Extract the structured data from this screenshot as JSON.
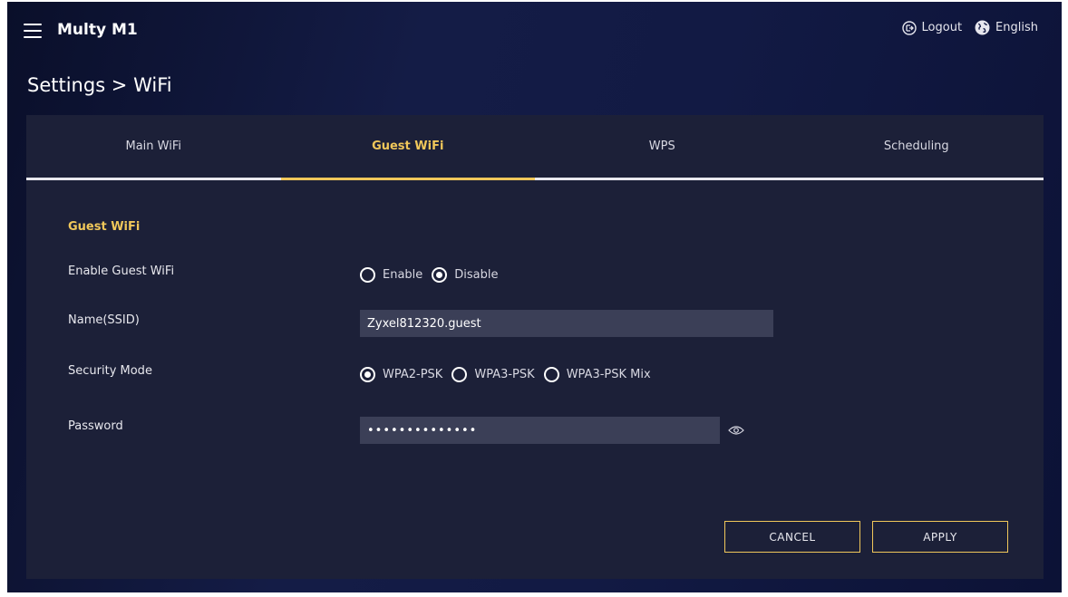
{
  "app": {
    "title": "Multy M1"
  },
  "header": {
    "logout_label": "Logout",
    "language_label": "English"
  },
  "breadcrumb": "Settings > WiFi",
  "tabs": [
    {
      "label": "Main WiFi",
      "active": false
    },
    {
      "label": "Guest WiFi",
      "active": true
    },
    {
      "label": "WPS",
      "active": false
    },
    {
      "label": "Scheduling",
      "active": false
    }
  ],
  "form": {
    "section_title": "Guest WiFi",
    "enable": {
      "label": "Enable Guest WiFi",
      "options": [
        "Enable",
        "Disable"
      ],
      "selected": "Disable"
    },
    "ssid": {
      "label": "Name(SSID)",
      "value": "Zyxel812320.guest"
    },
    "security": {
      "label": "Security Mode",
      "options": [
        "WPA2-PSK",
        "WPA3-PSK",
        "WPA3-PSK Mix"
      ],
      "selected": "WPA2-PSK"
    },
    "password": {
      "label": "Password",
      "value": "••••••••••••••"
    }
  },
  "buttons": {
    "cancel": "CANCEL",
    "apply": "APPLY"
  },
  "colors": {
    "accent": "#f0c75a",
    "panel": "#1c2038",
    "input": "#3b3f57"
  }
}
